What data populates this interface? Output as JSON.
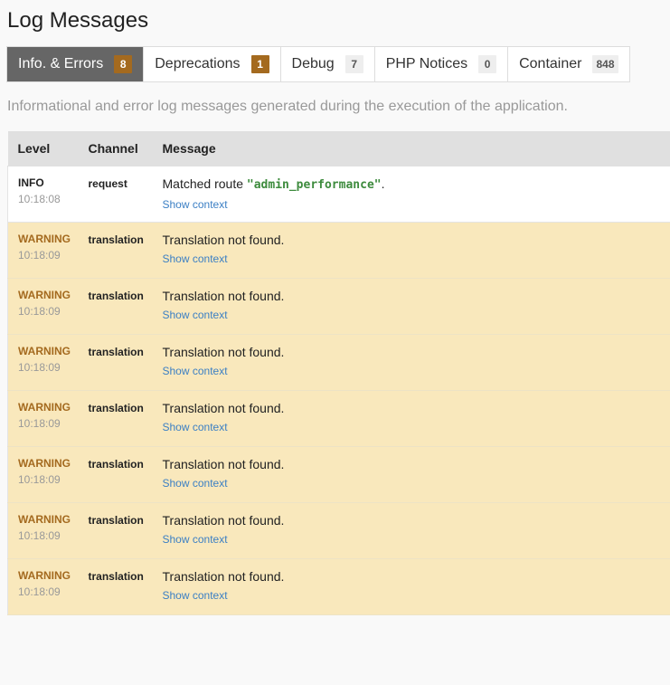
{
  "page": {
    "title": "Log Messages",
    "description": "Informational and error log messages generated during the execution of the application."
  },
  "tabs": [
    {
      "label": "Info. & Errors",
      "count": "8",
      "active": true,
      "badge_style": "warn"
    },
    {
      "label": "Deprecations",
      "count": "1",
      "active": false,
      "badge_style": "warn"
    },
    {
      "label": "Debug",
      "count": "7",
      "active": false,
      "badge_style": "plain"
    },
    {
      "label": "PHP Notices",
      "count": "0",
      "active": false,
      "badge_style": "plain"
    },
    {
      "label": "Container",
      "count": "848",
      "active": false,
      "badge_style": "plain"
    }
  ],
  "table": {
    "headers": {
      "level": "Level",
      "channel": "Channel",
      "message": "Message"
    },
    "rows": [
      {
        "level": "INFO",
        "time": "10:18:08",
        "channel": "request",
        "message_prefix": "Matched route ",
        "message_code": "\"admin_performance\"",
        "message_suffix": ".",
        "context_link": "Show context",
        "type": "info"
      },
      {
        "level": "WARNING",
        "time": "10:18:09",
        "channel": "translation",
        "message_prefix": "Translation not found.",
        "message_code": "",
        "message_suffix": "",
        "context_link": "Show context",
        "type": "warning"
      },
      {
        "level": "WARNING",
        "time": "10:18:09",
        "channel": "translation",
        "message_prefix": "Translation not found.",
        "message_code": "",
        "message_suffix": "",
        "context_link": "Show context",
        "type": "warning"
      },
      {
        "level": "WARNING",
        "time": "10:18:09",
        "channel": "translation",
        "message_prefix": "Translation not found.",
        "message_code": "",
        "message_suffix": "",
        "context_link": "Show context",
        "type": "warning"
      },
      {
        "level": "WARNING",
        "time": "10:18:09",
        "channel": "translation",
        "message_prefix": "Translation not found.",
        "message_code": "",
        "message_suffix": "",
        "context_link": "Show context",
        "type": "warning"
      },
      {
        "level": "WARNING",
        "time": "10:18:09",
        "channel": "translation",
        "message_prefix": "Translation not found.",
        "message_code": "",
        "message_suffix": "",
        "context_link": "Show context",
        "type": "warning"
      },
      {
        "level": "WARNING",
        "time": "10:18:09",
        "channel": "translation",
        "message_prefix": "Translation not found.",
        "message_code": "",
        "message_suffix": "",
        "context_link": "Show context",
        "type": "warning"
      },
      {
        "level": "WARNING",
        "time": "10:18:09",
        "channel": "translation",
        "message_prefix": "Translation not found.",
        "message_code": "",
        "message_suffix": "",
        "context_link": "Show context",
        "type": "warning"
      }
    ]
  },
  "colors": {
    "active_tab_bg": "#666666",
    "warning_badge": "#a46a1f",
    "warning_row_bg": "#f9e8bc",
    "link": "#3b7fc4",
    "code": "#3d8b3d"
  }
}
